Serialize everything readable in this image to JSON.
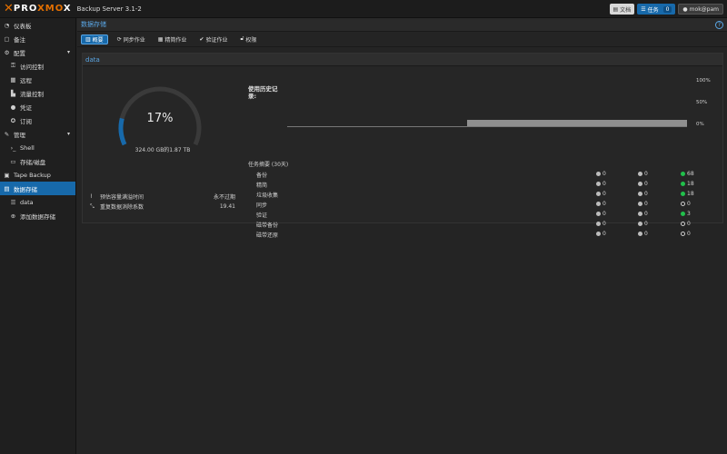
{
  "header": {
    "logo_left": "PRO",
    "logo_mid": "XMO",
    "logo_right": "X",
    "version": "Backup Server 3.1-2",
    "docs_label": "文档",
    "tasks_label": "任务",
    "tasks_count": "0",
    "user_label": "mok@pam"
  },
  "sidebar": {
    "items": [
      {
        "label": "仪表板",
        "icon": "dashboard-icon"
      },
      {
        "label": "备注",
        "icon": "notes-icon"
      },
      {
        "label": "配置",
        "icon": "gears-icon"
      },
      {
        "label": "访问控制",
        "icon": "key-icon"
      },
      {
        "label": "远程",
        "icon": "server-icon"
      },
      {
        "label": "流量控制",
        "icon": "traffic-icon"
      },
      {
        "label": "凭证",
        "icon": "certificate-icon"
      },
      {
        "label": "订阅",
        "icon": "support-icon"
      },
      {
        "label": "管理",
        "icon": "wrench-icon"
      },
      {
        "label": "Shell",
        "icon": "terminal-icon"
      },
      {
        "label": "存储/磁盘",
        "icon": "disk-icon"
      },
      {
        "label": "Tape Backup",
        "icon": "tape-icon"
      },
      {
        "label": "数据存储",
        "icon": "datastore-icon"
      },
      {
        "label": "data",
        "icon": "database-icon"
      },
      {
        "label": "添加数据存储",
        "icon": "plus-circle-icon"
      }
    ]
  },
  "main": {
    "title": "数据存储",
    "tabs": [
      {
        "label": "概要",
        "icon": "book-icon"
      },
      {
        "label": "同步作业",
        "icon": "refresh-icon"
      },
      {
        "label": "精简作业",
        "icon": "prune-icon"
      },
      {
        "label": "验证作业",
        "icon": "check-circle-icon"
      },
      {
        "label": "权限",
        "icon": "unlock-icon"
      }
    ],
    "panel_title": "data",
    "usage": {
      "percent_label": "17%",
      "percent": 17,
      "detail": "324.00 GB的1.87 TB"
    },
    "estimate_label": "预估容量满溢时间",
    "estimate_value": "永不过期",
    "dedup_label": "重复数据消除系数",
    "dedup_value": "19.41",
    "history_title": "使用历史记录:",
    "task_summary_title": "任务摘要 (30天)",
    "tasks": [
      {
        "name": "备份",
        "err": "0",
        "warn": "0",
        "ok": "68"
      },
      {
        "name": "精简",
        "err": "0",
        "warn": "0",
        "ok": "18"
      },
      {
        "name": "垃圾收集",
        "err": "0",
        "warn": "0",
        "ok": "18"
      },
      {
        "name": "同步",
        "err": "0",
        "warn": "0",
        "ok": "0"
      },
      {
        "name": "验证",
        "err": "0",
        "warn": "0",
        "ok": "3"
      },
      {
        "name": "磁带备份",
        "err": "0",
        "warn": "0",
        "ok": "0"
      },
      {
        "name": "磁带还原",
        "err": "0",
        "warn": "0",
        "ok": "0"
      }
    ]
  },
  "chart_data": {
    "type": "area",
    "title": "使用历史记录:",
    "y_ticks": [
      "100%",
      "50%",
      "0%"
    ],
    "ylim": [
      0,
      100
    ],
    "series": [
      {
        "values": [
          0,
          0,
          0,
          0,
          0,
          17,
          17,
          17,
          17,
          17,
          17,
          17
        ]
      }
    ],
    "grid": false
  },
  "colors": {
    "accent": "#1769aa",
    "brand_orange": "#e57000",
    "ok_green": "#21bf4b",
    "gauge_fill": "#1769aa",
    "gauge_track": "#3a3a3a"
  }
}
